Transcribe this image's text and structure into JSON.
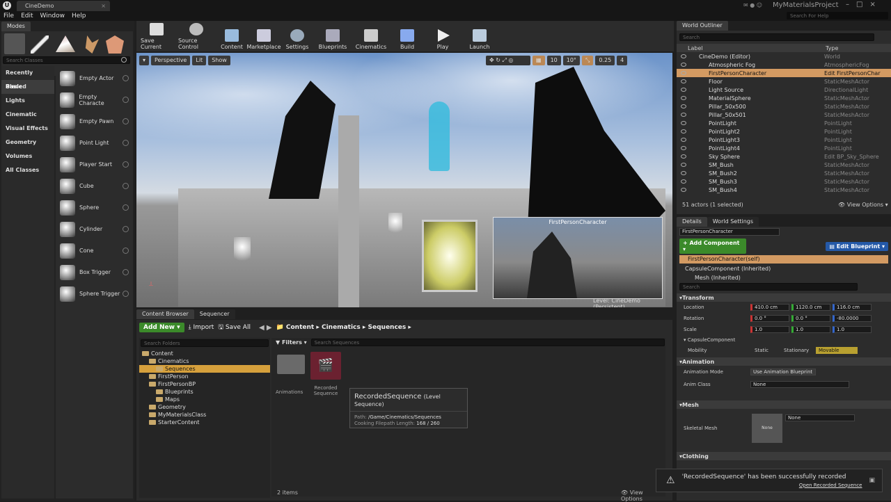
{
  "app": {
    "tab": "CineDemo",
    "project": "MyMaterialsProject",
    "help_search_placeholder": "Search For Help"
  },
  "menu": [
    "File",
    "Edit",
    "Window",
    "Help"
  ],
  "modes": {
    "tab": "Modes",
    "search_placeholder": "Search Classes",
    "categories": [
      "Recently Placed",
      "Basic",
      "Lights",
      "Cinematic",
      "Visual Effects",
      "Geometry",
      "Volumes",
      "All Classes"
    ],
    "actors": [
      "Empty Actor",
      "Empty Characte",
      "Empty Pawn",
      "Point Light",
      "Player Start",
      "Cube",
      "Sphere",
      "Cylinder",
      "Cone",
      "Box Trigger",
      "Sphere Trigger"
    ]
  },
  "toolbar": [
    "Save Current",
    "Source Control",
    "Content",
    "Marketplace",
    "Settings",
    "Blueprints",
    "Cinematics",
    "Build",
    "Play",
    "Launch"
  ],
  "viewport": {
    "perspective": "Perspective",
    "lit": "Lit",
    "show": "Show",
    "grid": "10",
    "angle": "10°",
    "scale": "0.25",
    "cam": "4",
    "pip_title": "FirstPersonCharacter",
    "level": "Level:  CineDemo (Persistent)"
  },
  "outliner": {
    "tab": "World Outliner",
    "search_placeholder": "Search",
    "col_label": "Label",
    "col_type": "Type",
    "rows": [
      {
        "label": "CineDemo (Editor)",
        "type": "World"
      },
      {
        "label": "Atmospheric Fog",
        "type": "AtmosphericFog"
      },
      {
        "label": "FirstPersonCharacter",
        "type": "Edit FirstPersonChar"
      },
      {
        "label": "Floor",
        "type": "StaticMeshActor"
      },
      {
        "label": "Light Source",
        "type": "DirectionalLight"
      },
      {
        "label": "MaterialSphere",
        "type": "StaticMeshActor"
      },
      {
        "label": "Pillar_50x500",
        "type": "StaticMeshActor"
      },
      {
        "label": "Pillar_50x501",
        "type": "StaticMeshActor"
      },
      {
        "label": "PointLight",
        "type": "PointLight"
      },
      {
        "label": "PointLight2",
        "type": "PointLight"
      },
      {
        "label": "PointLight3",
        "type": "PointLight"
      },
      {
        "label": "PointLight4",
        "type": "PointLight"
      },
      {
        "label": "Sky Sphere",
        "type": "Edit BP_Sky_Sphere"
      },
      {
        "label": "SM_Bush",
        "type": "StaticMeshActor"
      },
      {
        "label": "SM_Bush2",
        "type": "StaticMeshActor"
      },
      {
        "label": "SM_Bush3",
        "type": "StaticMeshActor"
      },
      {
        "label": "SM_Bush4",
        "type": "StaticMeshActor"
      }
    ],
    "status": "51 actors (1 selected)",
    "view_options": "View Options"
  },
  "details": {
    "tab": "Details",
    "tab2": "World Settings",
    "name": "FirstPersonCharacter",
    "add_component": "+ Add Component",
    "edit_blueprint": "Edit Blueprint",
    "self": "FirstPersonCharacter(self)",
    "capsule": "CapsuleComponent (Inherited)",
    "mesh": "Mesh (Inherited)",
    "search_placeholder": "Search",
    "transform": "Transform",
    "location": "Location",
    "rotation": "Rotation",
    "scale": "Scale",
    "loc": [
      "410.0 cm",
      "1120.0 cm",
      "116.0 cm"
    ],
    "rot": [
      "0.0 °",
      "0.0 °",
      "-80.0000"
    ],
    "scl": [
      "1.0",
      "1.0",
      "1.0"
    ],
    "capsule_sec": "CapsuleComponent",
    "mobility": "Mobility",
    "static": "Static",
    "stationary": "Stationary",
    "movable": "Movable",
    "animation": "Animation",
    "anim_mode": "Animation Mode",
    "anim_mode_val": "Use Animation Blueprint",
    "anim_class": "Anim Class",
    "none": "None",
    "mesh_sec": "Mesh",
    "skeletal_mesh": "Skeletal Mesh",
    "clothing": "Clothing"
  },
  "content": {
    "tab": "Content Browser",
    "tab2": "Sequencer",
    "add_new": "Add New",
    "import": "Import",
    "save_all": "Save All",
    "crumbs": [
      "Content",
      "Cinematics",
      "Sequences"
    ],
    "folder_search": "Search Folders",
    "filters": "Filters",
    "asset_search": "Search Sequences",
    "tree": [
      {
        "n": "Content",
        "d": 0
      },
      {
        "n": "Cinematics",
        "d": 1
      },
      {
        "n": "Sequences",
        "d": 2
      },
      {
        "n": "FirstPerson",
        "d": 1
      },
      {
        "n": "FirstPersonBP",
        "d": 1
      },
      {
        "n": "Blueprints",
        "d": 2
      },
      {
        "n": "Maps",
        "d": 2
      },
      {
        "n": "Geometry",
        "d": 1
      },
      {
        "n": "MyMaterialsClass",
        "d": 1
      },
      {
        "n": "StarterContent",
        "d": 1
      }
    ],
    "assets": [
      "Animations",
      "Recorded Sequence"
    ],
    "tooltip": {
      "name": "RecordedSequence",
      "kind": "(Level Sequence)",
      "path_label": "Path:",
      "path": "/Game/Cinematics/Sequences",
      "cook_label": "Cooking Filepath Length:",
      "cook": "168 / 260"
    },
    "items": "2 items",
    "view_options": "View Options"
  },
  "toast": {
    "msg": "'RecordedSequence' has been successfully recorded",
    "link": "Open Recorded Sequence"
  }
}
